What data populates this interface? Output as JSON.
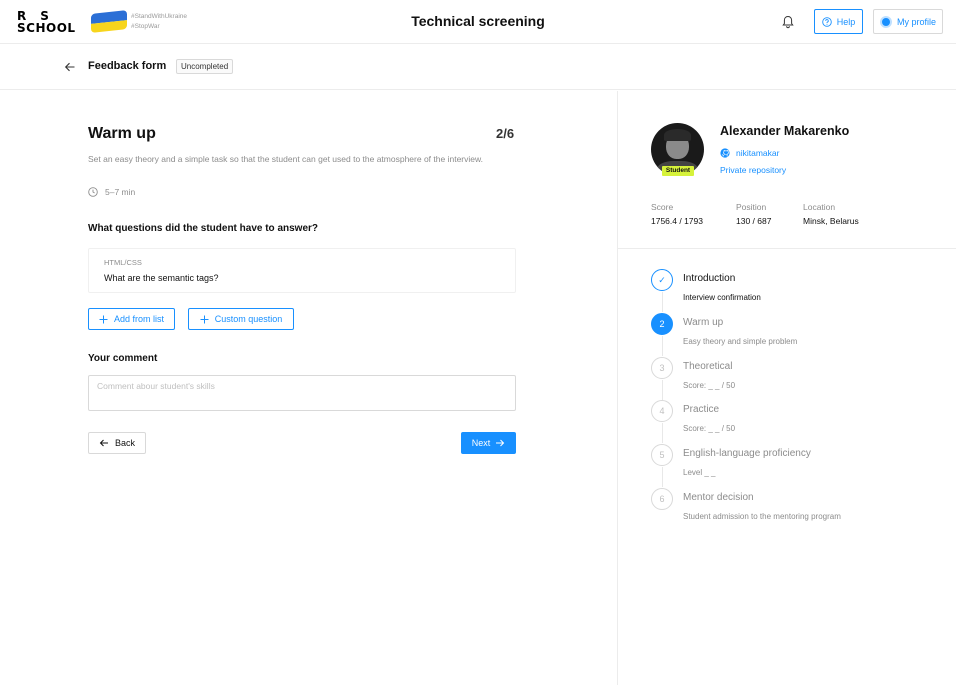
{
  "header": {
    "logo_line1": "RS",
    "logo_line2": "SCHOOL",
    "tag1": "#StandWithUkraine",
    "tag2": "#StopWar",
    "title": "Technical screening",
    "help_label": "Help",
    "profile_label": "My profile"
  },
  "subheader": {
    "title": "Feedback form",
    "status": "Uncompleted"
  },
  "step": {
    "title": "Warm up",
    "counter": "2/6",
    "description": "Set an easy theory and a simple task so that the student can get used to the atmosphere of the interview.",
    "duration": "5–7 min"
  },
  "questions": {
    "heading": "What questions did the student have to answer?",
    "items": [
      {
        "category": "HTML/CSS",
        "text": "What are the semantic tags?"
      }
    ],
    "add_from_list": "Add from list",
    "custom_question": "Custom question"
  },
  "comment": {
    "heading": "Your comment",
    "placeholder": "Comment abour student's skills"
  },
  "nav": {
    "back": "Back",
    "next": "Next"
  },
  "student": {
    "badge": "Student",
    "name": "Alexander Makarenko",
    "github": "nikitamakar",
    "repo": "Private repository",
    "stats": [
      {
        "label": "Score",
        "value": "1756.4 / 1793"
      },
      {
        "label": "Position",
        "value": "130 / 687"
      },
      {
        "label": "Location",
        "value": "Minsk, Belarus"
      }
    ]
  },
  "timeline": [
    {
      "num": "✓",
      "title": "Introduction",
      "sub": "Interview confirmation",
      "state": "done"
    },
    {
      "num": "2",
      "title": "Warm up",
      "sub": "Easy theory and simple problem",
      "state": "active"
    },
    {
      "num": "3",
      "title": "Theoretical",
      "sub": "Score: _ _ / 50",
      "state": "pending"
    },
    {
      "num": "4",
      "title": "Practice",
      "sub": "Score: _ _ / 50",
      "state": "pending"
    },
    {
      "num": "5",
      "title": "English-language proficiency",
      "sub": "Level _ _",
      "state": "pending"
    },
    {
      "num": "6",
      "title": "Mentor decision",
      "sub": "Student admission to the mentoring program",
      "state": "pending"
    }
  ],
  "colors": {
    "accent": "#1890ff",
    "student_badge": "#d6f23a",
    "flag_blue": "#2b6fd6",
    "flag_yellow": "#f7d51d"
  }
}
